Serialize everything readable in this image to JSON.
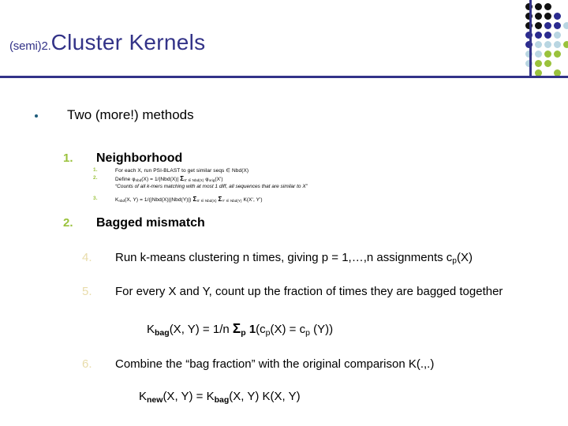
{
  "slide": {
    "title": {
      "prefix": "(semi)2.",
      "main": "Cluster Kernels"
    },
    "bullet": {
      "text": "Two (more!) methods"
    },
    "sections": [
      {
        "number": "1.",
        "heading": "Neighborhood",
        "sub_items": [
          {
            "number": "1.",
            "text": "For each X, run PSI-BLAST to get similar seqs ∈ Nbd(X)"
          },
          {
            "number": "2.",
            "text": "Define φnbd(X) = 1/|Nbd(X)| ΣX'∈Nbd(X) φorig(X')"
          }
        ],
        "note": "“Counts of all k-mers matching with at most 1 diff, all sequences that are similar to X”",
        "sub_item3": {
          "number": "3.",
          "text": "Knbd(X, Y) = 1/(|Nbd(X)||Nbd(Y)|) ΣX'∈Nbd(X) ΣY'∈Nbd(Y) K(X', Y')"
        }
      },
      {
        "number": "2.",
        "heading": "Bagged mismatch"
      }
    ],
    "items": [
      {
        "number": "4.",
        "text": "Run k-means clustering n times, giving p = 1,…,n assignments cp(X)"
      },
      {
        "number": "5.",
        "text": "For every X and Y, count up the fraction of times they are bagged together"
      },
      {
        "number": "6.",
        "text": "Combine the “bag fraction” with the original comparison K(.,.)"
      }
    ],
    "formulas": [
      {
        "text": "Kbag(X, Y) = 1/n Σp 1(cp(X) = cp (Y))"
      },
      {
        "text": "Knew(X, Y) = Kbag(X, Y) K(X, Y)"
      }
    ],
    "colors": {
      "title": "#333388",
      "rule": "#333388",
      "green_number": "#9ac23c",
      "blue_number": "#3f63b5",
      "tan_number": "#e8dcaa",
      "bullet": "#1f5c7a"
    },
    "decoration": {
      "dot_grid_palette": [
        "#111111",
        "#2b2b8f",
        "#3f63b5",
        "#b9d6e2",
        "#9ac23c"
      ]
    }
  }
}
